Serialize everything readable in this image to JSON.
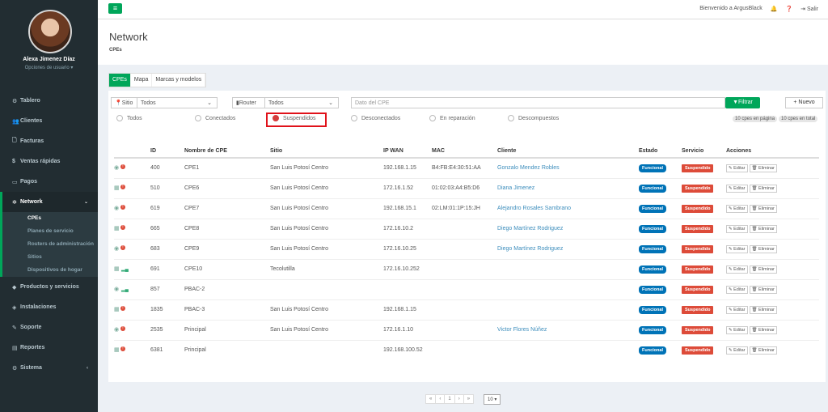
{
  "user": {
    "name": "Alexa Jimenez Díaz",
    "options": "Opciones de usuario ▾"
  },
  "nav": [
    {
      "label": "Tablero",
      "icon": "dashboard-icon",
      "glyph": "⚙"
    },
    {
      "label": "Clientes",
      "icon": "users-icon",
      "glyph": "👥"
    },
    {
      "label": "Facturas",
      "icon": "file-icon",
      "glyph": "🗋"
    },
    {
      "label": "Ventas rápidas",
      "icon": "dollar-icon",
      "glyph": "$"
    },
    {
      "label": "Pagos",
      "icon": "credit-card-icon",
      "glyph": "▭"
    },
    {
      "label": "Network",
      "icon": "network-icon",
      "glyph": "✲"
    },
    {
      "label": "Productos y servicios",
      "icon": "tag-icon",
      "glyph": "◆"
    },
    {
      "label": "Instalaciones",
      "icon": "wrench-icon",
      "glyph": "◈"
    },
    {
      "label": "Soporte",
      "icon": "tool-icon",
      "glyph": "✎"
    },
    {
      "label": "Reportes",
      "icon": "book-icon",
      "glyph": "▤"
    },
    {
      "label": "Sistema",
      "icon": "cogs-icon",
      "glyph": "⚙"
    }
  ],
  "network_sub": [
    "CPEs",
    "Planes de servicio",
    "Routers de administración",
    "Sitios",
    "Dispositivos de hogar"
  ],
  "topbar": {
    "welcome": "Bienvenido a ArgusBlack",
    "logout": "Salir"
  },
  "header": {
    "title": "Network",
    "crumb": "CPEs"
  },
  "tabs": [
    "CPEs",
    "Mapa",
    "Marcas y modelos"
  ],
  "filters": {
    "sitio_label": "Sitio",
    "sitio_value": "Todos",
    "router_label": "Router",
    "router_value": "Todos",
    "cpe_placeholder": "Dato del CPE",
    "filter_btn": "▼Filtrar",
    "new_btn": "+ Nuevo"
  },
  "radios": [
    "Todos",
    "Conectados",
    "Suspendidos",
    "Desconectados",
    "En reparación",
    "Descompuestos"
  ],
  "counts": {
    "page": "10 cpes en página",
    "total": "10 cpes en total"
  },
  "columns": [
    "ID",
    "Nombre de CPE",
    "Sitio",
    "IP WAN",
    "MAC",
    "Cliente",
    "Estado",
    "Servicio",
    "Acciones"
  ],
  "rows": [
    {
      "id": "400",
      "name": "CPE1",
      "site": "San Luis Potosí Centro",
      "ip": "192.168.1.15",
      "mac": "B4:FB:E4:30:51:AA",
      "client": "Gonzalo Mendez Robles"
    },
    {
      "id": "510",
      "name": "CPE6",
      "site": "San Luis Potosí Centro",
      "ip": "172.16.1.52",
      "mac": "01:02:03:A4:B5:D6",
      "client": "Diana Jimenez"
    },
    {
      "id": "619",
      "name": "CPE7",
      "site": "San Luis Potosí Centro",
      "ip": "192.168.15.1",
      "mac": "02:LM:01:1P:15:JH",
      "client": "Alejandro Rosales Sambrano"
    },
    {
      "id": "665",
      "name": "CPE8",
      "site": "San Luis Potosí Centro",
      "ip": "172.16.10.2",
      "mac": "",
      "client": "Diego Martínez Rodriguez"
    },
    {
      "id": "683",
      "name": "CPE9",
      "site": "San Luis Potosí Centro",
      "ip": "172.16.10.25",
      "mac": "",
      "client": "Diego Martínez Rodriguez"
    },
    {
      "id": "691",
      "name": "CPE10",
      "site": "Tecolutilla",
      "ip": "172.16.10.252",
      "mac": "",
      "client": ""
    },
    {
      "id": "857",
      "name": "PBAC-2",
      "site": "",
      "ip": "",
      "mac": "",
      "client": ""
    },
    {
      "id": "1835",
      "name": "PBAC-3",
      "site": "San Luis Potosí Centro",
      "ip": "192.168.1.15",
      "mac": "",
      "client": ""
    },
    {
      "id": "2535",
      "name": "Principal",
      "site": "San Luis Potosí Centro",
      "ip": "172.16.1.10",
      "mac": "",
      "client": "Victor Flores Núñez"
    },
    {
      "id": "6381",
      "name": "Principal",
      "site": "",
      "ip": "192.168.100.52",
      "mac": "",
      "client": ""
    }
  ],
  "row_labels": {
    "estado": "Funcional",
    "servicio": "Suspendido",
    "edit": "✎ Editar",
    "delete": "🗑 Eliminar"
  },
  "pagination": {
    "first": "«",
    "prev": "‹",
    "page": "1",
    "next": "›",
    "last": "»",
    "per_page": "10 ▾"
  }
}
